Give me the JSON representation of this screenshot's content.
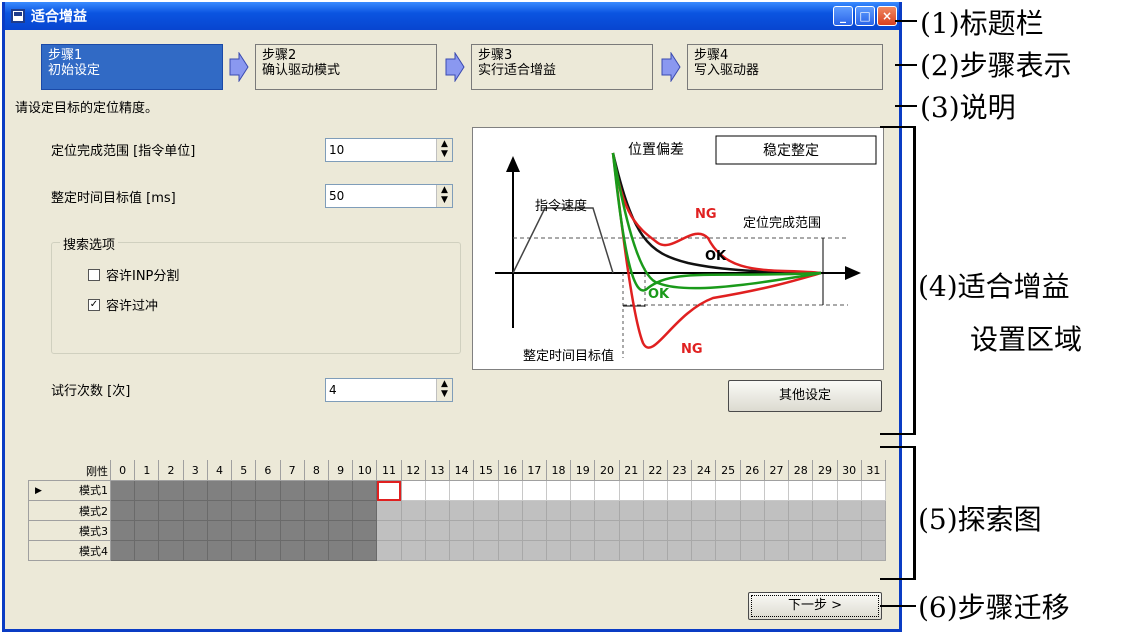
{
  "window": {
    "title": "适合增益",
    "controls": [
      "_",
      "□",
      "×"
    ]
  },
  "steps": [
    {
      "line1": "步骤1",
      "line2": "初始设定",
      "active": true
    },
    {
      "line1": "步骤2",
      "line2": "确认驱动模式",
      "active": false
    },
    {
      "line1": "步骤3",
      "line2": "实行适合增益",
      "active": false
    },
    {
      "line1": "步骤4",
      "line2": "写入驱动器",
      "active": false
    }
  ],
  "description": "请设定目标的定位精度。",
  "fields": {
    "inp_range": {
      "label": "定位完成范围 [指令单位]",
      "value": "10"
    },
    "settle_time": {
      "label": "整定时间目标值 [ms]",
      "value": "50"
    },
    "trials": {
      "label": "试行次数 [次]",
      "value": "4"
    }
  },
  "search_options": {
    "title": "搜索选项",
    "allow_inp_split": {
      "label": "容许INP分割",
      "checked": false
    },
    "allow_overshoot": {
      "label": "容许过冲",
      "checked": true
    }
  },
  "diagram": {
    "position_deviation": "位置偏差",
    "stable_settling": "稳定整定",
    "command_speed": "指令速度",
    "inp_range": "定位完成范围",
    "settle_target": "整定时间目标值",
    "ok": "OK",
    "ng": "NG"
  },
  "other_settings_button": "其他设定",
  "search_map": {
    "header_label": "刚性",
    "columns": [
      "0",
      "1",
      "2",
      "3",
      "4",
      "5",
      "6",
      "7",
      "8",
      "9",
      "10",
      "11",
      "12",
      "13",
      "14",
      "15",
      "16",
      "17",
      "18",
      "19",
      "20",
      "21",
      "22",
      "23",
      "24",
      "25",
      "26",
      "27",
      "28",
      "29",
      "30",
      "31"
    ],
    "rows": [
      "模式1",
      "模式2",
      "模式3",
      "模式4"
    ],
    "current_row_marker": "▶",
    "searched_through": 10,
    "current_col": 11
  },
  "next_button": "下一步 >",
  "callouts": {
    "c1": "(1)标题栏",
    "c2": "(2)步骤表示",
    "c3": "(3)说明",
    "c4a": "(4)适合增益",
    "c4b": "设置区域",
    "c5": "(5)探索图",
    "c6": "(6)步骤迁移"
  },
  "colors": {
    "titlebar": "#0a54e0",
    "active_step": "#316ac5",
    "ok_curve": "#000000",
    "green_curve": "#1a9a1a",
    "ng_curve": "#e02020"
  }
}
